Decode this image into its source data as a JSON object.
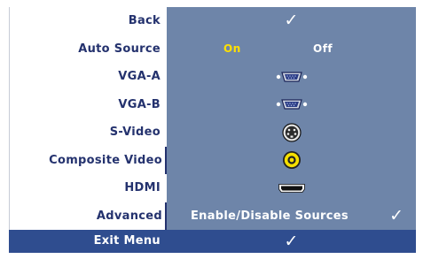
{
  "menu": {
    "rows": [
      {
        "label": "Back"
      },
      {
        "label": "Auto Source",
        "option_on": "On",
        "option_off": "Off",
        "selected": "On"
      },
      {
        "label": "VGA-A",
        "icon": "vga-connector-icon"
      },
      {
        "label": "VGA-B",
        "icon": "vga-connector-icon"
      },
      {
        "label": "S-Video",
        "icon": "s-video-connector-icon"
      },
      {
        "label": "Composite Video",
        "icon": "composite-video-connector-icon"
      },
      {
        "label": "HDMI",
        "icon": "hdmi-connector-icon"
      },
      {
        "label": "Advanced",
        "value": "Enable/Disable Sources"
      }
    ],
    "check_glyph": "✓",
    "exit_label": "Exit Menu"
  },
  "colors": {
    "panel_blue": "#6e85a9",
    "exit_bar_blue": "#2f4d8f",
    "label_navy": "#24326e",
    "on_yellow": "#ffe000"
  }
}
